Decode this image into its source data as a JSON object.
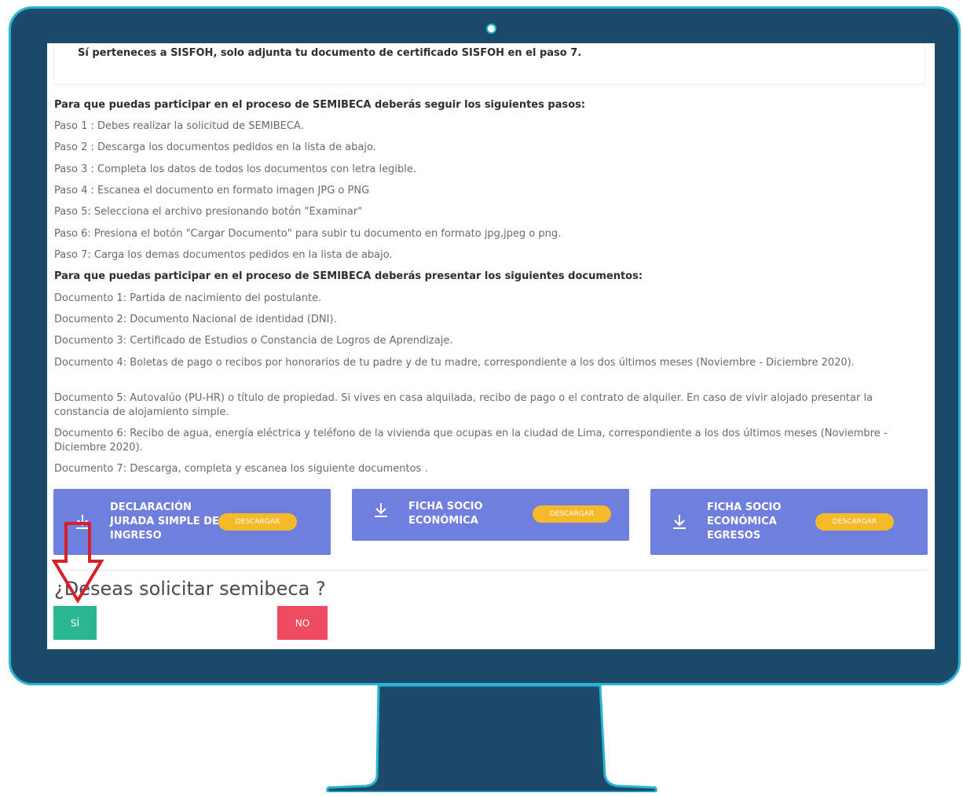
{
  "notice": "Sí perteneces a SISFOH, solo adjunta tu documento de certificado SISFOH en el paso 7.",
  "steps_heading": "Para que puedas participar en el proceso de SEMIBECA deberás seguir los siguientes pasos:",
  "steps": [
    "Paso 1 : Debes realizar la solicitud de SEMIBECA.",
    "Paso 2 : Descarga los documentos pedidos en la lista de abajo.",
    "Paso 3 : Completa los datos de todos los documentos con letra legible.",
    "Paso 4 : Escanea el documento en formato imagen JPG o PNG",
    "Paso 5: Selecciona el archivo presionando botón \"Examinar\"",
    "Paso 6: Presiona el botón \"Cargar Documento\" para subir tu documento en formato jpg,jpeg o png.",
    "Paso 7: Carga los demas documentos pedidos en la lista de abajo."
  ],
  "docs_heading": "Para que puedas participar en el proceso de SEMIBECA deberás presentar los siguientes documentos:",
  "documents": [
    "Documento 1: Partida de nacimiento del postulante.",
    "Documento 2: Documento Nacional de identidad (DNI).",
    "Documento 3: Certificado de Estudios o Constancia de Logros de Aprendizaje.",
    "Documento 4: Boletas de pago o recibos por honorarios de tu padre y de tu madre, correspondiente a los dos últimos meses (Noviembre - Diciembre 2020).",
    "Documento 5: Autovalúo (PU-HR) o título de propiedad. Si vives en casa alquilada, recibo de pago o el contrato de alquiler. En caso de vivir alojado presentar la constancia de alojamiento simple.",
    "Documento 6: Recibo de agua, energía eléctrica y teléfono de la vivienda que ocupas en la ciudad de Lima, correspondiente a los dos últimos meses (Noviembre - Diciembre 2020).",
    "Documento 7: Descarga, completa y escanea los siguiente documentos ."
  ],
  "cards": [
    {
      "title": "DECLARACIÓN JURADA SIMPLE DE INGRESO",
      "button": "DESCARGAR",
      "icon": "download-icon"
    },
    {
      "title": "FICHA SOCIO ECONÓMICA",
      "button": "DESCARGAR",
      "icon": "download-icon"
    },
    {
      "title": "FICHA SOCIO ECONÓMICA EGRESOS",
      "button": "DESCARGAR",
      "icon": "download-icon"
    }
  ],
  "question": "¿Deseas solicitar semibeca ?",
  "yes_label": "SÍ",
  "no_label": "NO",
  "colors": {
    "bezel": "#1b4a6b",
    "bezel_border": "#27b5d3",
    "card": "#6e7fdd",
    "download_button": "#f6b928",
    "yes_button": "#2bb692",
    "no_button": "#ee4b62",
    "annotation_arrow": "#d6202a"
  }
}
